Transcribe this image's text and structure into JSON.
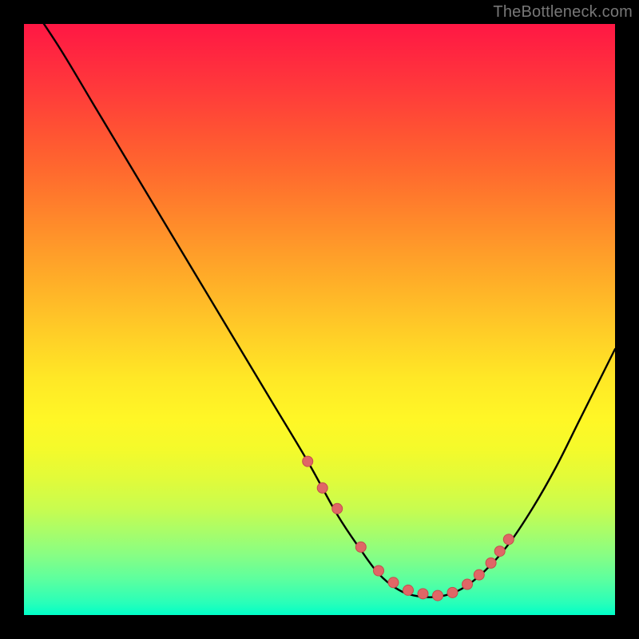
{
  "watermark": "TheBottleneck.com",
  "colors": {
    "background": "#000000",
    "curve_stroke": "#000000",
    "dot_fill": "#e06666",
    "dot_stroke": "#c44d4d"
  },
  "chart_data": {
    "type": "line",
    "title": "",
    "xlabel": "",
    "ylabel": "",
    "xlim": [
      0,
      100
    ],
    "ylim": [
      0,
      100
    ],
    "series": [
      {
        "name": "curve",
        "x": [
          0,
          6,
          12,
          18,
          24,
          30,
          36,
          42,
          48,
          53,
          57,
          60,
          63,
          66,
          70,
          74,
          78,
          82,
          86,
          90,
          94,
          98,
          100
        ],
        "y": [
          105,
          96,
          86,
          76,
          66,
          56,
          46,
          36,
          26,
          17,
          11,
          7,
          4.5,
          3.3,
          3.1,
          4.4,
          7.5,
          12,
          18,
          25,
          33,
          41,
          45
        ]
      }
    ],
    "dots": {
      "name": "highlighted-points",
      "x": [
        48,
        50.5,
        53,
        57,
        60,
        62.5,
        65,
        67.5,
        70,
        72.5,
        75,
        77,
        79,
        80.5,
        82
      ],
      "y": [
        26,
        21.5,
        18,
        11.5,
        7.5,
        5.5,
        4.2,
        3.6,
        3.3,
        3.8,
        5.2,
        6.8,
        8.8,
        10.8,
        12.8
      ]
    }
  }
}
